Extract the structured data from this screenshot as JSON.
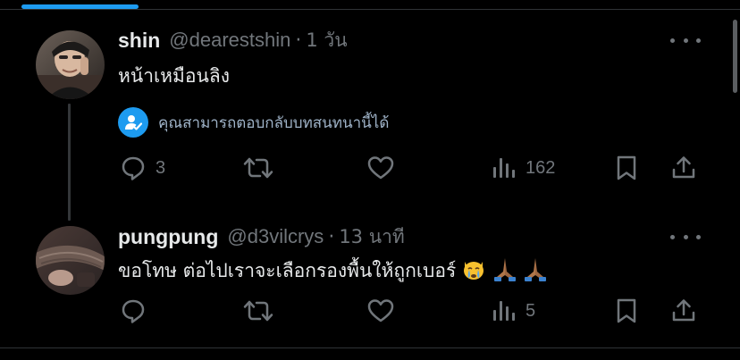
{
  "colors": {
    "background": "#000000",
    "primary_text": "#e7e9ea",
    "secondary_text": "#71767b",
    "accent": "#1d9bf0",
    "divider": "#2f3336"
  },
  "tweets": [
    {
      "display_name": "shin",
      "handle": "@dearestshin",
      "separator": "·",
      "time": "1 วัน",
      "text": "หน้าเหมือนลิง",
      "reply_note": "คุณสามารถตอบกลับบทสนทนานี้ได้",
      "reply_note_icon": "person-check-icon",
      "actions": {
        "reply_count": "3",
        "retweet_count": "",
        "like_count": "",
        "views_count": "162"
      }
    },
    {
      "display_name": "pungpung",
      "handle": "@d3vilcrys",
      "separator": "·",
      "time": "13 นาที",
      "text": "ขอโทษ ต่อไปเราจะเลือกรองพื้นให้ถูกเบอร์",
      "emojis": [
        "crying-cat-face-icon",
        "folded-hands-icon",
        "folded-hands-icon"
      ],
      "actions": {
        "reply_count": "",
        "retweet_count": "",
        "like_count": "",
        "views_count": "5"
      }
    }
  ]
}
